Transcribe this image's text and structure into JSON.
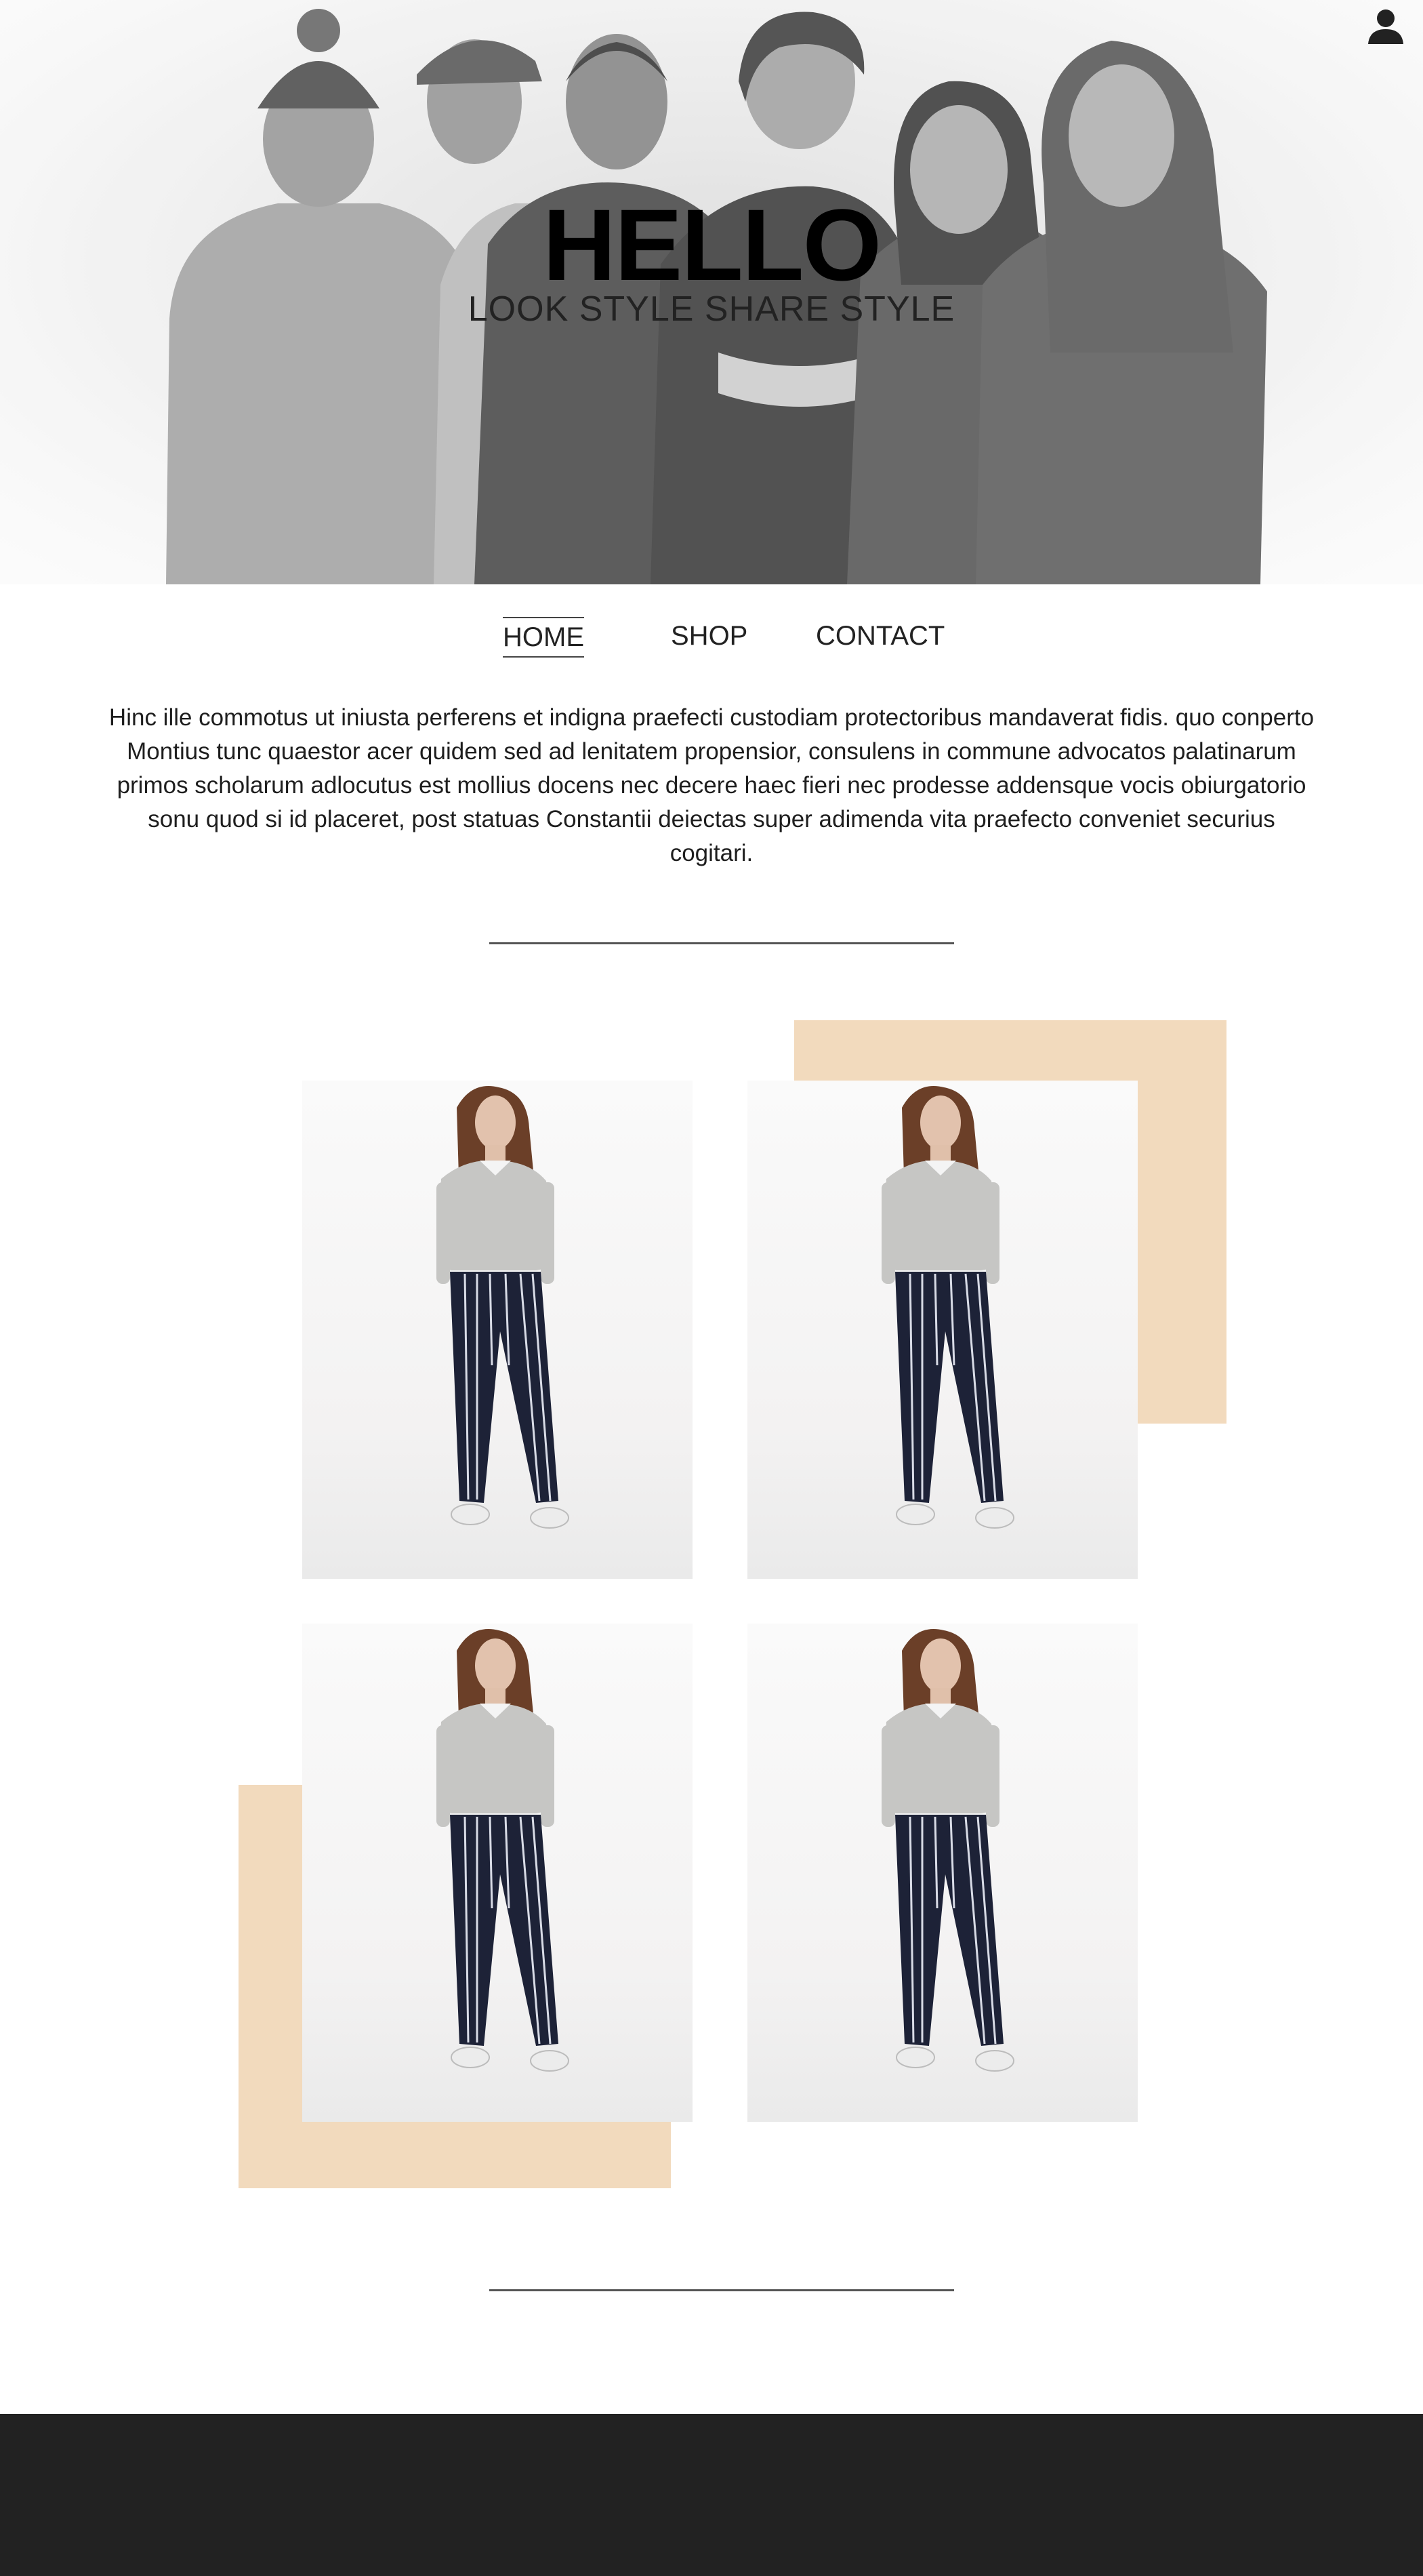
{
  "hero": {
    "title": "HELLO",
    "subtitle": "LOOK STYLE SHARE STYLE",
    "background_image": "group-of-five-people-black-and-white-photo",
    "account_icon": "user-icon"
  },
  "nav": {
    "items": [
      {
        "label": "HOME",
        "active": true
      },
      {
        "label": "SHOP",
        "active": false
      },
      {
        "label": "CONTACT",
        "active": false
      }
    ]
  },
  "intro": {
    "text": "Hinc ille commotus ut iniusta perferens et indigna praefecti custodiam protectoribus mandaverat fidis. quo conperto Montius tunc quaestor acer quidem sed ad lenitatem propensior, consulens in commune advocatos palatinarum primos scholarum adlocutus est mollius docens nec decere haec fieri nec prodesse addensque vocis obiurgatorio sonu quod si id placeret, post statuas Constantii deiectas super adimenda vita praefecto conveniet securius cogitari."
  },
  "gallery": {
    "items": [
      {
        "image": "woman-grey-sweater-striped-navy-trousers"
      },
      {
        "image": "woman-grey-sweater-striped-navy-trousers"
      },
      {
        "image": "woman-grey-sweater-striped-navy-trousers"
      },
      {
        "image": "woman-grey-sweater-striped-navy-trousers"
      }
    ]
  },
  "colors": {
    "accent": "#f2dabd",
    "footer": "#222222",
    "text": "#222222",
    "background": "#ffffff"
  }
}
